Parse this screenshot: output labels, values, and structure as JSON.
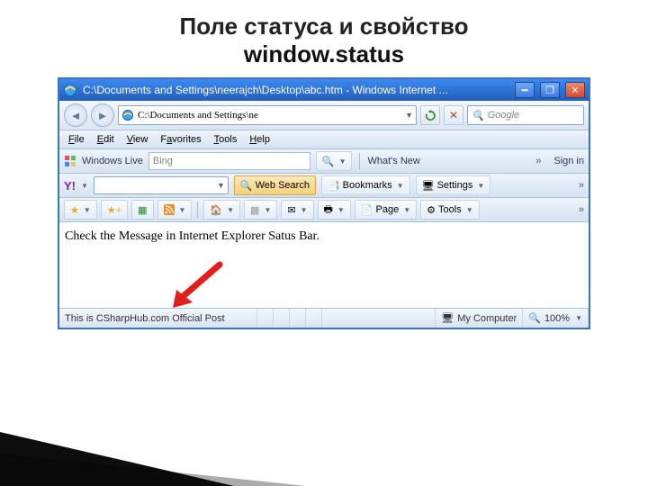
{
  "slide": {
    "title_line1": "Поле статуса и свойство",
    "title_line2": "window.status"
  },
  "titlebar": {
    "text": "C:\\Documents and Settings\\neerajch\\Desktop\\abc.htm - Windows Internet ..."
  },
  "address": {
    "value": "C:\\Documents and Settings\\ne"
  },
  "search": {
    "placeholder": "Google"
  },
  "menubar": {
    "file": "File",
    "edit": "Edit",
    "view": "View",
    "favorites": "Favorites",
    "tools": "Tools",
    "help": "Help"
  },
  "wlbar": {
    "label": "Windows Live",
    "bing": "Bing",
    "whatsnew": "What's New",
    "signin": "Sign in"
  },
  "ybar": {
    "websearch": "Web Search",
    "bookmarks": "Bookmarks",
    "settings": "Settings"
  },
  "pagebar": {
    "page": "Page",
    "tools": "Tools"
  },
  "content": {
    "text": "Check the Message in Internet Explorer Satus Bar."
  },
  "statusbar": {
    "message": "This is CSharpHub.com Official Post",
    "zone": "My Computer",
    "zoom": "100%"
  }
}
